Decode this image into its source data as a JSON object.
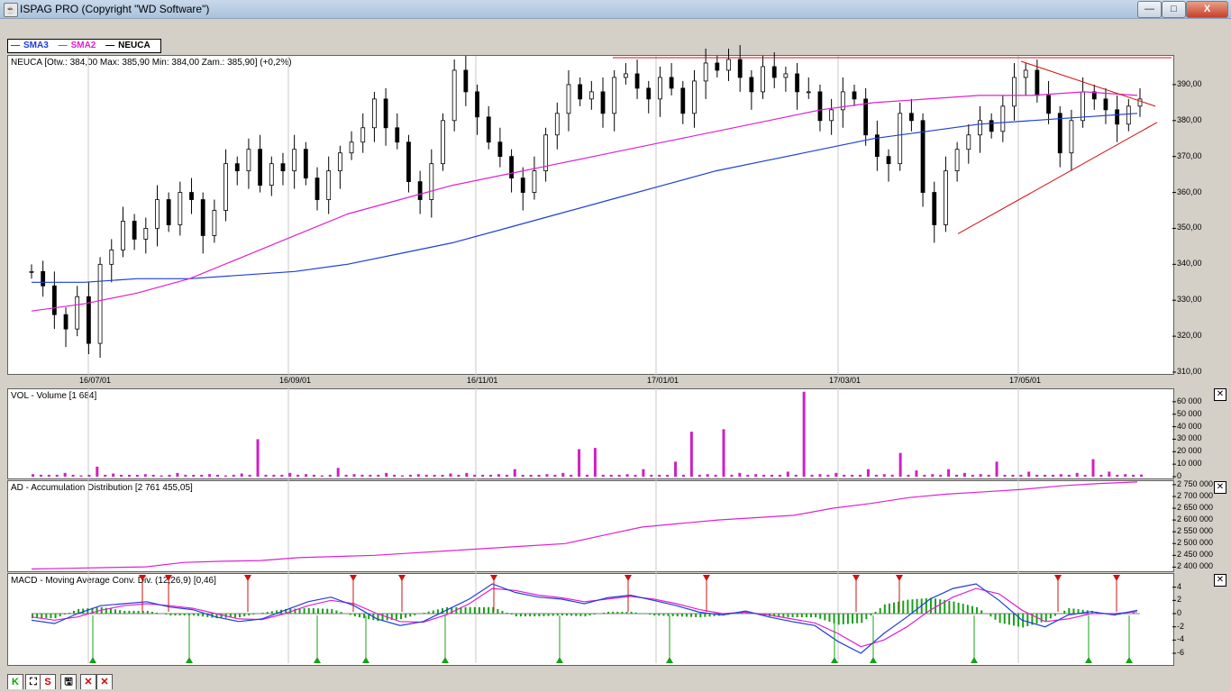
{
  "window": {
    "title": "ISPAG PRO (Copyright \"WD Software\")",
    "min": "—",
    "max": "□",
    "close": "X"
  },
  "legend": [
    {
      "label": "SMA3",
      "color": "#1e3fd8"
    },
    {
      "label": "SMA2",
      "color": "#e020d0"
    },
    {
      "label": "NEUCA",
      "color": "#000000"
    }
  ],
  "panels": {
    "price": {
      "label": "NEUCA [Otw.: 384,00  Max: 385,90  Min: 384,00  Zam.: 385,90] (+0,2%)"
    },
    "volume": {
      "label": "VOL - Volume [1 684]"
    },
    "ad": {
      "label": "AD - Accumulation Distribution [2 761 455,05]"
    },
    "macd": {
      "label": "MACD - Moving Average Conv. Div. (12,26,9) [0,46]"
    }
  },
  "toolbar": [
    "K",
    "⛶",
    "S",
    "🖫",
    "✕",
    "✕"
  ],
  "chart_data": [
    {
      "type": "candlestick",
      "ticker": "NEUCA",
      "x_ticks": [
        "16/07/01",
        "16/09/01",
        "16/11/01",
        "17/01/01",
        "17/03/01",
        "17/05/01"
      ],
      "y_ticks": [
        "310,00",
        "320,00",
        "330,00",
        "340,00",
        "350,00",
        "360,00",
        "370,00",
        "380,00",
        "390,00"
      ],
      "ylim": [
        310,
        398
      ],
      "close_series": [
        338,
        334,
        326,
        322,
        331,
        318,
        340,
        344,
        352,
        347,
        350,
        358,
        351,
        360,
        358,
        348,
        355,
        368,
        366,
        372,
        362,
        368,
        366,
        372,
        364,
        358,
        366,
        371,
        374,
        378,
        386,
        378,
        374,
        363,
        358,
        368,
        380,
        394,
        388,
        381,
        374,
        370,
        364,
        360,
        366,
        376,
        382,
        390,
        386,
        388,
        382,
        392,
        393,
        389,
        386,
        392,
        389,
        382,
        391,
        396,
        394,
        397,
        392,
        388,
        395,
        392,
        393,
        388,
        388,
        380,
        383,
        388,
        386,
        376,
        370,
        368,
        382,
        380,
        360,
        351,
        366,
        372,
        376,
        380,
        377,
        384,
        392,
        394,
        387,
        382,
        371,
        380,
        388,
        386,
        383,
        379,
        384,
        386
      ],
      "sma_blue": [
        335,
        335,
        336,
        336,
        337,
        338,
        340,
        343,
        346,
        350,
        354,
        358,
        362,
        366,
        369,
        372,
        375,
        377,
        379,
        380,
        381,
        382
      ],
      "sma_magenta": [
        327,
        329,
        332,
        336,
        342,
        348,
        354,
        358,
        362,
        365,
        368,
        371,
        374,
        377,
        380,
        383,
        385,
        386,
        387,
        387,
        388,
        387
      ],
      "last": {
        "open": "384,00",
        "max": "385,90",
        "min": "384,00",
        "close": "385,90",
        "change": "+0,2%"
      }
    },
    {
      "type": "bar",
      "name": "VOL - Volume",
      "y_ticks": [
        "0",
        "10 000",
        "20 000",
        "30 000",
        "40 000",
        "50 000",
        "60 000"
      ],
      "ylim": [
        0,
        70000
      ],
      "values": [
        2000,
        1500,
        3000,
        1000,
        8000,
        2500,
        1500,
        2000,
        1000,
        3000,
        1500,
        2000,
        1000,
        2500,
        30000,
        1500,
        3000,
        2000,
        1000,
        7000,
        2000,
        1500,
        3000,
        1000,
        2000,
        1500,
        2500,
        3000,
        1500,
        2000,
        6000,
        1500,
        2000,
        3000,
        22000,
        23000,
        1500,
        2000,
        6000,
        1500,
        12000,
        36000,
        2000,
        38000,
        3000,
        2000,
        1500,
        4000,
        68000,
        2000,
        3000,
        1500,
        6000,
        2000,
        19000,
        5000,
        2000,
        6000,
        3000,
        2000,
        12000,
        1500,
        4000,
        1500,
        2000,
        3000,
        14000,
        4000,
        2000,
        1684
      ]
    },
    {
      "type": "line",
      "name": "AD - Accumulation Distribution",
      "y_ticks": [
        "2 400 000",
        "2 450 000",
        "2 500 000",
        "2 550 000",
        "2 600 000",
        "2 650 000",
        "2 700 000",
        "2 750 000"
      ],
      "ylim": [
        2390000,
        2765000
      ],
      "values": [
        2392000,
        2395000,
        2398000,
        2401000,
        2420000,
        2425000,
        2428000,
        2440000,
        2445000,
        2450000,
        2460000,
        2470000,
        2480000,
        2490000,
        2500000,
        2535000,
        2570000,
        2585000,
        2600000,
        2610000,
        2620000,
        2650000,
        2670000,
        2695000,
        2710000,
        2720000,
        2730000,
        2745000,
        2755000,
        2761455
      ]
    },
    {
      "type": "line",
      "name": "MACD - Moving Average Conv. Div.",
      "params": "(12,26,9)",
      "last": "0,46",
      "y_ticks": [
        "4",
        "2",
        "0",
        "-2",
        "-4",
        "-6"
      ],
      "ylim": [
        -7.5,
        6
      ],
      "macd": [
        -1,
        -1.5,
        0,
        1.2,
        1.5,
        1.8,
        1,
        0.6,
        -0.5,
        -1.2,
        -0.8,
        0.5,
        1.8,
        2.5,
        1.2,
        -0.8,
        -1.8,
        -1.2,
        0.5,
        2.2,
        4.5,
        3.2,
        2.5,
        2.2,
        1.5,
        2.4,
        2.8,
        2,
        1.2,
        0.2,
        -0.2,
        0.4,
        -0.5,
        -1.2,
        -1.8,
        -4.2,
        -6,
        -3,
        -0.5,
        2.2,
        3.8,
        4.5,
        2,
        -1,
        -2,
        -0.2,
        0.3,
        -0.2,
        0.5
      ],
      "signal": [
        -0.5,
        -1,
        -0.5,
        0.5,
        1.2,
        1.5,
        1.2,
        0.8,
        0,
        -0.8,
        -0.9,
        0,
        1.2,
        2,
        1.5,
        0,
        -1.2,
        -1.3,
        -0.2,
        1.5,
        3.8,
        3.5,
        2.8,
        2.4,
        1.8,
        2.2,
        2.6,
        2.2,
        1.5,
        0.6,
        0,
        0.2,
        -0.2,
        -0.8,
        -1.4,
        -3,
        -5,
        -4,
        -2,
        0.5,
        2.5,
        3.8,
        3,
        0.5,
        -1.2,
        -0.8,
        0,
        0,
        0.3
      ]
    }
  ]
}
